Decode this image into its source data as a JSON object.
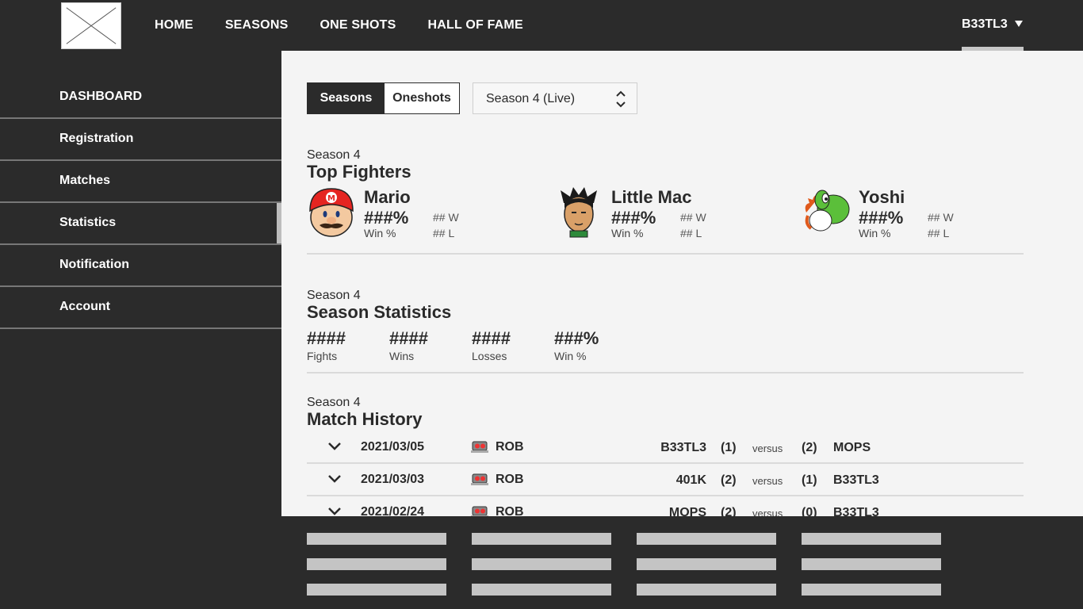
{
  "header": {
    "logo_icon": "placeholder-logo-icon",
    "nav": [
      "HOME",
      "SEASONS",
      "ONE SHOTS",
      "HALL OF FAME"
    ],
    "user": "B33TL3"
  },
  "sidebar": {
    "items": [
      {
        "label": "DASHBOARD"
      },
      {
        "label": "Registration"
      },
      {
        "label": "Matches"
      },
      {
        "label": "Statistics",
        "active": true
      },
      {
        "label": "Notification"
      },
      {
        "label": "Account"
      }
    ]
  },
  "filters": {
    "toggle_on": "Seasons",
    "toggle_off": "Oneshots",
    "season_select": "Season 4 (Live)"
  },
  "top_fighters": {
    "subtitle": "Season 4",
    "title": "Top Fighters",
    "fighters": [
      {
        "name": "Mario",
        "pct": "###%",
        "pct_label": "Win %",
        "w": "## W",
        "l": "## L",
        "icon": "mario-icon"
      },
      {
        "name": "Little Mac",
        "pct": "###%",
        "pct_label": "Win %",
        "w": "## W",
        "l": "## L",
        "icon": "little-mac-icon"
      },
      {
        "name": "Yoshi",
        "pct": "###%",
        "pct_label": "Win %",
        "w": "## W",
        "l": "## L",
        "icon": "yoshi-icon"
      }
    ]
  },
  "season_stats": {
    "subtitle": "Season 4",
    "title": "Season Statistics",
    "stats": [
      {
        "value": "####",
        "label": "Fights"
      },
      {
        "value": "####",
        "label": "Wins"
      },
      {
        "value": "####",
        "label": "Losses"
      },
      {
        "value": "###%",
        "label": "Win %"
      }
    ]
  },
  "match_history": {
    "subtitle": "Season 4",
    "title": "Match History",
    "versus_label": "versus",
    "rows": [
      {
        "date": "2021/03/05",
        "char": "ROB",
        "p1": "B33TL3",
        "s1": "(1)",
        "s2": "(2)",
        "p2": "MOPS"
      },
      {
        "date": "2021/03/03",
        "char": "ROB",
        "p1": "401K",
        "s1": "(2)",
        "s2": "(1)",
        "p2": "B33TL3"
      },
      {
        "date": "2021/02/24",
        "char": "ROB",
        "p1": "MOPS",
        "s1": "(2)",
        "s2": "(0)",
        "p2": "B33TL3"
      }
    ]
  },
  "colors": {
    "dark": "#2b2b2b",
    "light_bg": "#f4f4f4",
    "placeholder_bar": "#c4c4c4"
  }
}
